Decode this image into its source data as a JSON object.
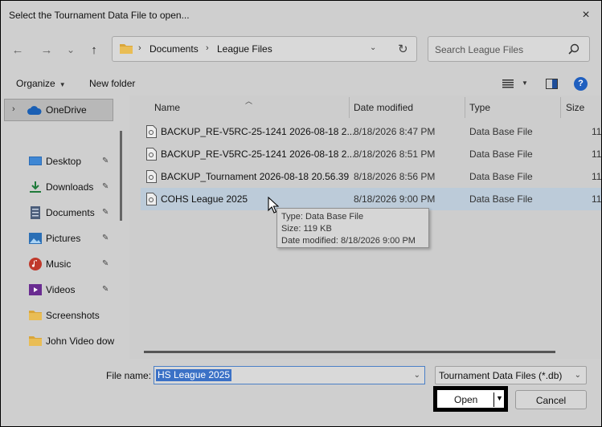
{
  "window": {
    "title": "Select the Tournament Data File to open...",
    "close_icon": "×"
  },
  "nav": {
    "back_icon": "←",
    "forward_icon": "→",
    "recent_icon": "⌄",
    "up_icon": "↑",
    "breadcrumb": [
      {
        "sep": "›",
        "label": "Documents"
      },
      {
        "sep": "›",
        "label": "League Files"
      }
    ],
    "dropdown_icon": "⌄",
    "refresh_icon": "↻",
    "search_placeholder": "Search League Files"
  },
  "toolbar": {
    "organize": "Organize",
    "new_folder": "New folder",
    "help": "?"
  },
  "sidebar": {
    "onedrive": "OneDrive",
    "items": [
      {
        "label": "Desktop",
        "icon": "desktop-icon",
        "pinned": true
      },
      {
        "label": "Downloads",
        "icon": "download-icon",
        "pinned": true
      },
      {
        "label": "Documents",
        "icon": "documents-icon",
        "pinned": true
      },
      {
        "label": "Pictures",
        "icon": "pictures-icon",
        "pinned": true
      },
      {
        "label": "Music",
        "icon": "music-icon",
        "pinned": true
      },
      {
        "label": "Videos",
        "icon": "videos-icon",
        "pinned": true
      },
      {
        "label": "Screenshots",
        "icon": "folder-icon",
        "pinned": false
      },
      {
        "label": "John Video dow",
        "icon": "folder-icon",
        "pinned": false
      }
    ],
    "pin_glyph": "📌"
  },
  "columns": {
    "name": "Name",
    "date": "Date modified",
    "type": "Type",
    "size": "Size"
  },
  "files": [
    {
      "name": "BACKUP_RE-V5RC-25-1241 2026-08-18 2...",
      "date": "8/18/2026 8:47 PM",
      "type": "Data Base File",
      "size": "11",
      "selected": false
    },
    {
      "name": "BACKUP_RE-V5RC-25-1241 2026-08-18 2...",
      "date": "8/18/2026 8:51 PM",
      "type": "Data Base File",
      "size": "11",
      "selected": false
    },
    {
      "name": "BACKUP_Tournament 2026-08-18 20.56.39",
      "date": "8/18/2026 8:56 PM",
      "type": "Data Base File",
      "size": "11",
      "selected": false
    },
    {
      "name": "COHS League 2025",
      "date": "8/18/2026 9:00 PM",
      "type": "Data Base File",
      "size": "11",
      "selected": true
    }
  ],
  "tooltip": {
    "type": "Type: Data Base File",
    "size": "Size: 119 KB",
    "date": "Date modified: 8/18/2026 9:00 PM"
  },
  "bottom": {
    "file_name_label": "File name:",
    "file_name_value": "HS League 2025",
    "file_type": "Tournament Data Files (*.db)",
    "open": "Open",
    "cancel": "Cancel"
  },
  "colors": {
    "accent": "#3b71c6",
    "selection": "#bccbd9",
    "background": "#cfcfcf"
  }
}
